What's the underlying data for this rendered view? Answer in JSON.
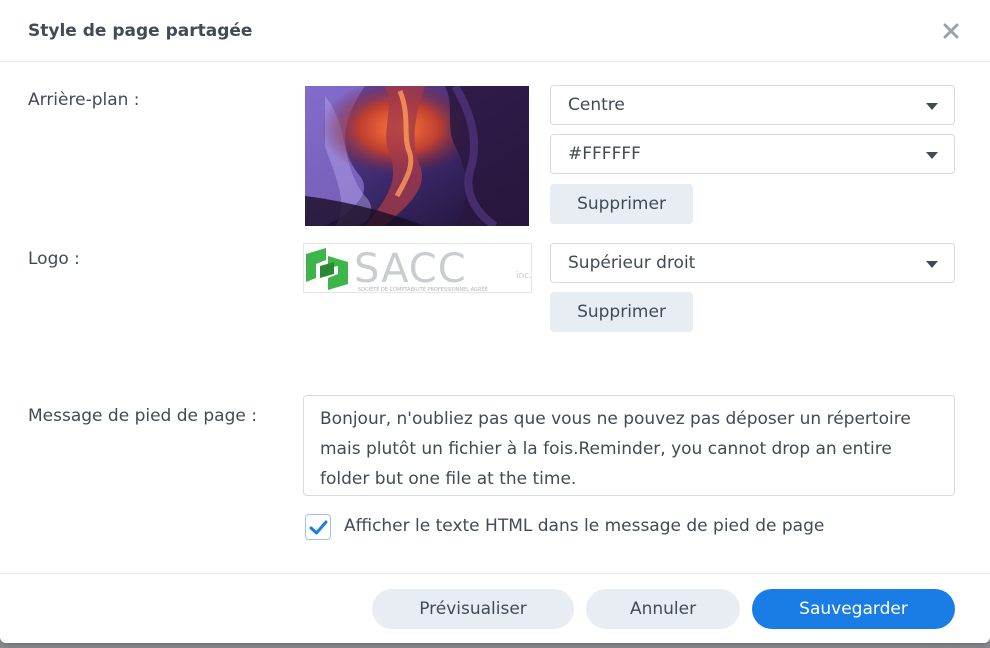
{
  "dialog": {
    "title": "Style de page partagée"
  },
  "background": {
    "label": "Arrière-plan :",
    "position_value": "Centre",
    "color_value": "#FFFFFF",
    "delete_label": "Supprimer"
  },
  "logo": {
    "label": "Logo :",
    "position_value": "Supérieur droit",
    "delete_label": "Supprimer",
    "brand_text": "SACC",
    "brand_suffix": "inc.",
    "brand_tagline": "SOCIÉTÉ DE COMPTABILITÉ PROFESSIONNEL AGRÉÉ"
  },
  "footer_message": {
    "label": "Message de pied de page :",
    "text": "Bonjour, n'oubliez pas que vous ne pouvez pas déposer un répertoire mais plutôt un fichier à la fois.Reminder, you cannot drop an entire folder but one file at the time.",
    "html_checkbox_label": "Afficher le texte HTML dans le message de pied de page",
    "html_checked": true
  },
  "buttons": {
    "preview": "Prévisualiser",
    "cancel": "Annuler",
    "save": "Sauvegarder"
  },
  "colors": {
    "accent": "#1a7de6",
    "text": "#414b55",
    "button_gray": "#e8edf3",
    "logo_green": "#3eb54a"
  },
  "icons": {
    "close": "close-icon",
    "dropdown": "caret-down-icon",
    "check": "check-icon"
  }
}
